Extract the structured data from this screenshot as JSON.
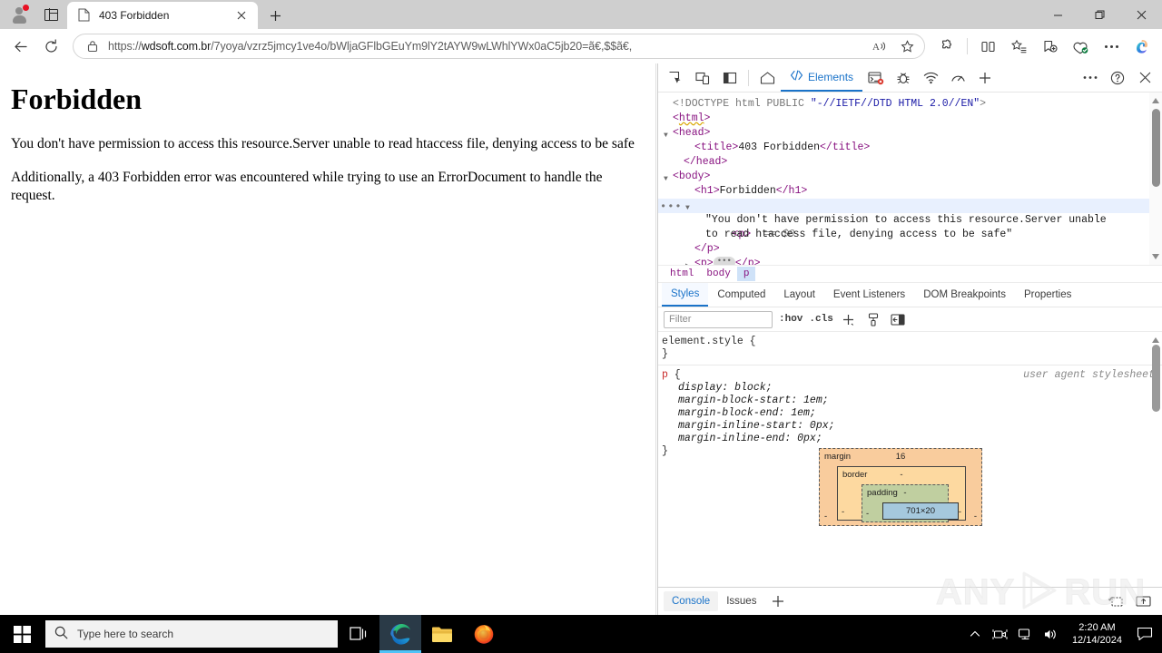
{
  "window": {
    "minimize_label": "Minimize",
    "maximize_label": "Maximize",
    "close_label": "Close"
  },
  "browser": {
    "profile_icon": "account-avatar-icon",
    "tab_actions_icon": "tab-actions-icon",
    "tab": {
      "title": "403 Forbidden",
      "favicon": "page-file-icon",
      "close_icon": "close-icon"
    },
    "new_tab_label": "+",
    "toolbar": {
      "back_icon": "back-arrow-icon",
      "refresh_icon": "refresh-icon",
      "lock_icon": "lock-icon",
      "url": "https://wdsoft.com.br/7yoya/vzrz5jmcy1ve4o/bWljaGFlbGEuYm9lY2tAYW9wLWhlYWx0aC5jb20=ã€,$$ã€,",
      "url_host": "wdsoft.com.br",
      "url_scheme": "https://",
      "url_path": "/7yoya/vzrz5jmcy1ve4o/bWljaGFlbGEuYm9lY2tAYW9wLWhlYWx0aC5jb20=ã€,$$ã€,",
      "read_aloud_icon": "read-aloud-icon",
      "favorite_icon": "favorite-star-icon",
      "extensions_icon": "extensions-puzzle-icon",
      "split_screen_icon": "split-screen-icon",
      "collections_icon": "collections-icon",
      "add_favorite_icon": "add-to-favorites-icon",
      "browser_essentials_icon": "browser-essentials-icon",
      "settings_more_icon": "settings-and-more-icon",
      "copilot_icon": "copilot-icon"
    }
  },
  "page": {
    "heading": "Forbidden",
    "paragraph1": "You don't have permission to access this resource.Server unable to read htaccess file, denying access to be safe",
    "paragraph2": "Additionally, a 403 Forbidden error was encountered while trying to use an ErrorDocument to handle the request."
  },
  "devtools": {
    "toolbar": {
      "inspect_icon": "inspect-element-icon",
      "device_toolbar_icon": "device-toolbar-icon",
      "dock_side_icon": "dock-side-icon",
      "home_icon": "home-icon",
      "elements_tab": "Elements",
      "elements_icon": "code-brackets-icon",
      "console_icon": "console-icon",
      "sources_icon": "debugger-bug-icon",
      "network_icon": "network-wifi-icon",
      "performance_icon": "performance-gauge-icon",
      "more_tabs_icon": "add-panel-icon",
      "more_options_icon": "more-options-icon",
      "help_icon": "help-icon",
      "close_icon": "close-devtools-icon"
    },
    "dom": {
      "lines": [
        "<!DOCTYPE html PUBLIC \"-//IETF//DTD HTML 2.0//EN\">",
        "<html>",
        "<head>",
        "<title>403 Forbidden</title>",
        "</head>",
        "<body>",
        "<h1>Forbidden</h1>",
        "<p> == $0",
        "\"You don't have permission to access this resource.Server unable to read htaccess file, denying access to be safe\"",
        "</p>",
        "<p>…</p>"
      ],
      "doctype": "<!DOCTYPE html PUBLIC \"-//IETF//DTD HTML 2.0//EN\">",
      "title_text": "403 Forbidden",
      "h1_text": "Forbidden",
      "selected_marker": "== $0",
      "p_text": "\"You don't have permission to access this resource.Server unable to read htaccess file, denying access to be safe\"",
      "tag_html": "html",
      "tag_head": "head",
      "tag_title": "title",
      "tag_body": "body",
      "tag_h1": "h1",
      "tag_p": "p"
    },
    "breadcrumb": [
      "html",
      "body",
      "p"
    ],
    "sidebar_tabs": [
      "Styles",
      "Computed",
      "Layout",
      "Event Listeners",
      "DOM Breakpoints",
      "Properties"
    ],
    "active_sidebar_tab": "Styles",
    "styles": {
      "filter_placeholder": "Filter",
      "hov_label": ":hov",
      "cls_label": ".cls",
      "new_rule_icon": "new-style-rule-icon",
      "class_icon": "element-classes-icon",
      "computed_toggle_icon": "toggle-computed-sidebar-icon",
      "rules": [
        {
          "selector": "element.style",
          "origin": "",
          "declarations": []
        },
        {
          "selector": "p",
          "origin": "user agent stylesheet",
          "declarations": [
            "display: block;",
            "margin-block-start: 1em;",
            "margin-block-end: 1em;",
            "margin-inline-start: 0px;",
            "margin-inline-end: 0px;"
          ]
        }
      ]
    },
    "box_model": {
      "margin_label": "margin",
      "margin_top": "16",
      "margin_left": "-",
      "margin_right": "-",
      "border_label": "border",
      "border_top": "-",
      "border_left": "-",
      "border_right": "-",
      "padding_label": "padding",
      "padding_top": "-",
      "padding_left": "-",
      "padding_right": "-",
      "content_size": "701×20"
    },
    "drawer": {
      "tabs": [
        "Console",
        "Issues"
      ],
      "active_tab": "Console",
      "add_icon": "add-drawer-tab-icon",
      "live_expression_icon": "live-expression-icon",
      "settings_icon": "drawer-settings-icon"
    }
  },
  "watermark": {
    "text_any": "ANY",
    "text_run": "RUN"
  },
  "taskbar": {
    "start_icon": "windows-start-icon",
    "search_icon": "search-icon",
    "search_placeholder": "Type here to search",
    "task_view_icon": "task-view-icon",
    "apps": [
      {
        "name": "edge-taskbar-icon",
        "active": true
      },
      {
        "name": "file-explorer-taskbar-icon",
        "active": false
      },
      {
        "name": "firefox-taskbar-icon",
        "active": false
      }
    ],
    "tray": {
      "show_hidden_icon": "show-hidden-icons-chevron",
      "camera_icon": "camera-tray-icon",
      "network_icon": "network-tray-icon",
      "volume_icon": "volume-tray-icon",
      "time": "2:20 AM",
      "date": "12/14/2024",
      "notification_icon": "notification-center-icon"
    }
  },
  "colors": {
    "accent_blue": "#1a73c9",
    "tag_purple": "#881280",
    "selector_red": "#c92c2c",
    "taskbar_active": "#4fc3f7",
    "notification_red": "#e81123"
  }
}
